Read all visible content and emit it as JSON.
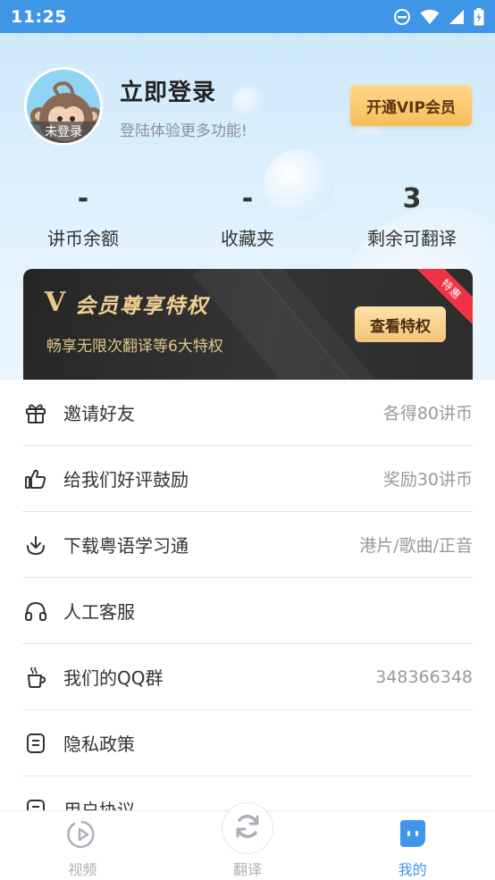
{
  "status_bar": {
    "time": "11:25"
  },
  "profile": {
    "badge": "未登录",
    "title": "立即登录",
    "subtitle": "登陆体验更多功能!",
    "vip_button": "开通VIP会员"
  },
  "stats": [
    {
      "value": "-",
      "label": "讲币余额"
    },
    {
      "value": "-",
      "label": "收藏夹"
    },
    {
      "value": "3",
      "label": "剩余可翻译"
    }
  ],
  "vip_banner": {
    "logo": "V",
    "title": "会员尊享特权",
    "description": "畅享无限次翻译等6大特权",
    "button": "查看特权",
    "ribbon": "特惠"
  },
  "menu": [
    {
      "icon": "gift-icon",
      "label": "邀请好友",
      "extra": "各得80讲币"
    },
    {
      "icon": "thumbs-up-icon",
      "label": "给我们好评鼓励",
      "extra": "奖励30讲币"
    },
    {
      "icon": "download-icon",
      "label": "下载粤语学习通",
      "extra": "港片/歌曲/正音"
    },
    {
      "icon": "headphones-icon",
      "label": "人工客服",
      "extra": ""
    },
    {
      "icon": "coffee-cup-icon",
      "label": "我们的QQ群",
      "extra": "348366348"
    },
    {
      "icon": "document-icon",
      "label": "隐私政策",
      "extra": ""
    },
    {
      "icon": "document-icon",
      "label": "用户协议",
      "extra": ""
    }
  ],
  "bottom_nav": [
    {
      "icon": "play-icon",
      "label": "视频",
      "active": false
    },
    {
      "icon": "refresh-icon",
      "label": "翻译",
      "active": false
    },
    {
      "icon": "profile-icon",
      "label": "我的",
      "active": true
    }
  ],
  "colors": {
    "status_bar": "#3f95e6",
    "accent": "#3e97ea",
    "vip_gold": "#f7bd57",
    "ribbon_red": "#ee3444"
  }
}
